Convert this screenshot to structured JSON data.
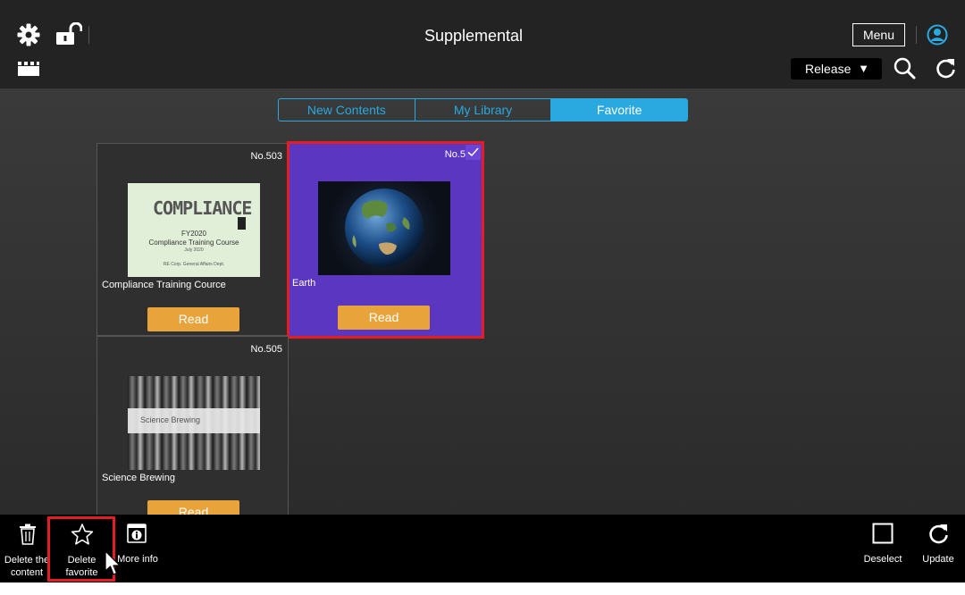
{
  "header": {
    "title": "Supplemental",
    "menu_label": "Menu"
  },
  "subheader": {
    "release_label": "Release",
    "release_caret": "▼"
  },
  "tabs": [
    {
      "label": "New Contents",
      "active": false
    },
    {
      "label": "My Library",
      "active": false
    },
    {
      "label": "Favorite",
      "active": true
    }
  ],
  "cards": [
    {
      "number": "No.503",
      "name": "Compliance Training Cource",
      "read_label": "Read",
      "thumb": {
        "title": "COMPLIANCE",
        "line1": "FY2020",
        "line2": "Compliance Training Course",
        "line3": "July 2020",
        "footer": "RE Corp. General Affairs Dept."
      }
    },
    {
      "number": "No.5",
      "name": "Earth",
      "read_label": "Read",
      "selected": true
    },
    {
      "number": "No.505",
      "name": "Science Brewing",
      "read_label": "Read",
      "thumb": {
        "overlay": "Science Brewing"
      }
    }
  ],
  "toolbar": {
    "delete_content_line1": "Delete the",
    "delete_content_line2": "content",
    "delete_favorite_line1": "Delete",
    "delete_favorite_line2": "favorite",
    "more_info": "More info",
    "deselect": "Deselect",
    "update": "Update"
  },
  "colors": {
    "accent": "#29a9e0",
    "selected_card": "#5b36c0",
    "read_button": "#e8a43a",
    "highlight": "#e41c23"
  }
}
